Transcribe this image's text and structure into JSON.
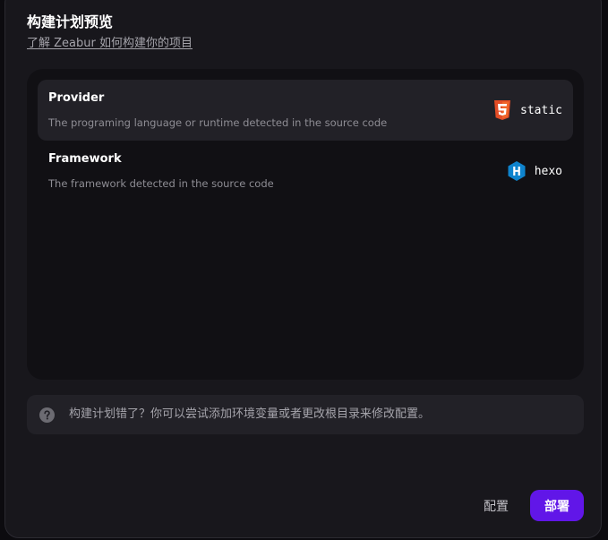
{
  "header": {
    "title": "构建计划预览",
    "learn_link": "了解 Zeabur 如何构建你的项目"
  },
  "plan": {
    "rows": [
      {
        "title": "Provider",
        "description": "The programing language or runtime detected in the source code",
        "value": "static",
        "icon": "html5-icon",
        "active": true
      },
      {
        "title": "Framework",
        "description": "The framework detected in the source code",
        "value": "hexo",
        "icon": "hexo-icon",
        "active": false
      }
    ]
  },
  "hint": {
    "icon": "question-circle-icon",
    "text": "构建计划错了？你可以尝试添加环境变量或者更改根目录来修改配置。"
  },
  "footer": {
    "config_label": "配置",
    "deploy_label": "部署"
  },
  "colors": {
    "dialog_background": "#18171c",
    "panel_background": "#111014",
    "row_active_background": "#222127",
    "accent": "#6116e8",
    "html5_orange": "#e44d26",
    "hexo_blue": "#0e83cd"
  }
}
